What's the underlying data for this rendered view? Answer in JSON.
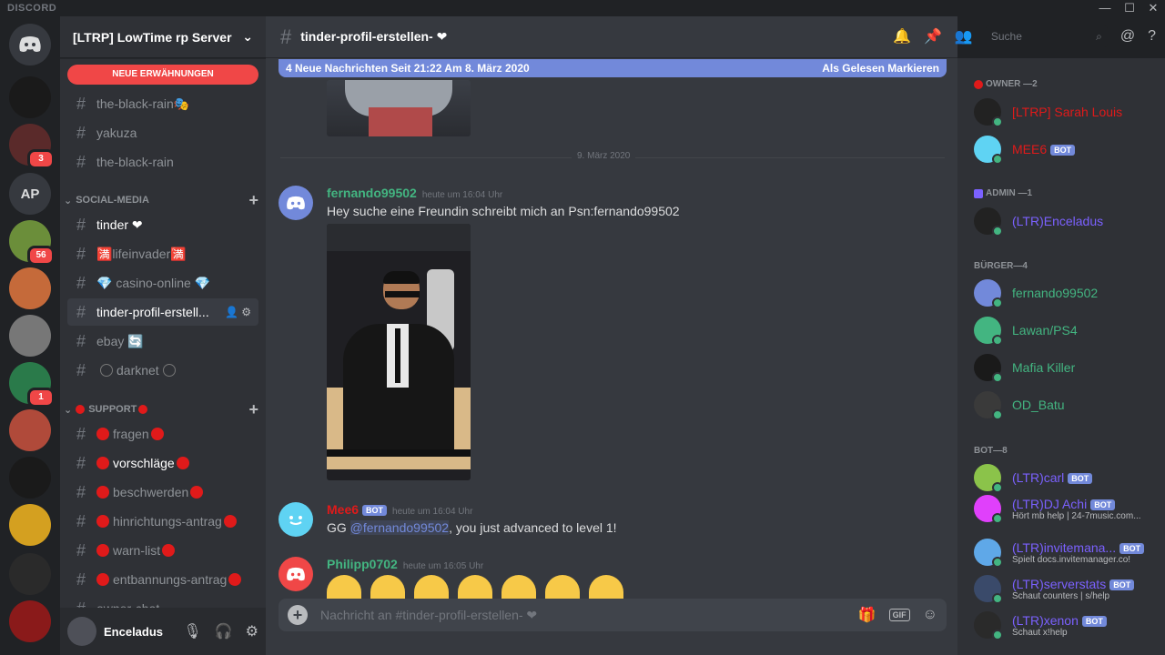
{
  "window": {
    "brand": "DISCORD",
    "minimize": "—",
    "maximize": "☐",
    "close": "✕"
  },
  "guilds": [
    {
      "label": "",
      "color": "#1a1a1a",
      "badge": ""
    },
    {
      "label": "",
      "color": "#5a2a2a",
      "badge": "3"
    },
    {
      "label": "AP",
      "color": "#36393f",
      "badge": ""
    },
    {
      "label": "",
      "color": "#6b8e3a",
      "badge": "56"
    },
    {
      "label": "",
      "color": "#c56a3a",
      "badge": ""
    },
    {
      "label": "",
      "color": "#777",
      "badge": ""
    },
    {
      "label": "",
      "color": "#2a7a4a",
      "badge": "1"
    },
    {
      "label": "",
      "color": "#b04a3a",
      "badge": ""
    },
    {
      "label": "",
      "color": "#1a1a1a",
      "badge": ""
    },
    {
      "label": "",
      "color": "#d4a020",
      "badge": ""
    },
    {
      "label": "",
      "color": "#2a2a2a",
      "badge": ""
    },
    {
      "label": "",
      "color": "#8a1a1a",
      "badge": ""
    }
  ],
  "server": {
    "name": "[LTRP] LowTime rp Server",
    "mention_pill": "NEUE ERWÄHNUNGEN"
  },
  "channels_top": [
    {
      "name": "the-black-rain🎭",
      "state": "normal"
    },
    {
      "name": "yakuza",
      "state": "normal"
    },
    {
      "name": "the-black-rain",
      "state": "normal"
    }
  ],
  "cat_social": "SOCIAL-MEDIA",
  "channels_social": [
    {
      "name": "tinder ❤",
      "state": "unread"
    },
    {
      "name": "🈵lifeinvader🈵",
      "state": "normal"
    },
    {
      "name": "💎 casino-online 💎",
      "state": "normal"
    },
    {
      "name": "tinder-profil-erstell...",
      "state": "active"
    },
    {
      "name": "ebay 🔄",
      "state": "normal"
    },
    {
      "name": "darknet",
      "state": "normal"
    }
  ],
  "cat_support": "SUPPORT",
  "channels_support": [
    {
      "name": "fragen",
      "state": "normal"
    },
    {
      "name": "vorschläge",
      "state": "unread"
    },
    {
      "name": "beschwerden",
      "state": "normal"
    },
    {
      "name": "hinrichtungs-antrag",
      "state": "normal"
    },
    {
      "name": "warn-list",
      "state": "normal"
    },
    {
      "name": "entbannungs-antrag",
      "state": "normal"
    },
    {
      "name": "owner-chat",
      "state": "normal"
    }
  ],
  "user": {
    "name": "Enceladus"
  },
  "chat": {
    "channel": "tinder-profil-erstellen- ❤",
    "new_messages": "4 Neue Nachrichten Seit 21:22 Am 8. März 2020",
    "mark_read": "Als Gelesen Markieren",
    "date_divider": "9. März 2020",
    "search_placeholder": "Suche",
    "composer_placeholder": "Nachricht an #tinder-profil-erstellen- ❤"
  },
  "messages": [
    {
      "author": "fernando99502",
      "author_color": "#43b581",
      "time": "heute um 16:04 Uhr",
      "text": "Hey suche eine Freundin schreibt mich an Psn:fernando99502"
    },
    {
      "author": "Mee6",
      "author_color": "#e01a1a",
      "bot": "BOT",
      "time": "heute um 16:04 Uhr",
      "text_pre": "GG ",
      "mention": "@fernando99502",
      "text_post": ", you just advanced to level 1!"
    },
    {
      "author": "Philipp0702",
      "author_color": "#43b581",
      "time": "heute um 16:05 Uhr"
    }
  ],
  "members": {
    "owner_title": "OWNER —2",
    "admin_title": "ADMIN —1",
    "buerger_title": "BÜRGER—4",
    "bot_title": "BOT—8",
    "list": [
      {
        "name": "[LTRP] Sarah Louis",
        "color": "#e01a1a",
        "sub": "",
        "bot": ""
      },
      {
        "name": "MEE6",
        "color": "#e01a1a",
        "sub": "",
        "bot": "BOT"
      },
      {
        "name": "(LTR)Enceladus",
        "color": "#7b61ff",
        "sub": "",
        "bot": ""
      },
      {
        "name": "fernando99502",
        "color": "#43b581",
        "sub": "",
        "bot": ""
      },
      {
        "name": "Lawan/PS4",
        "color": "#43b581",
        "sub": "",
        "bot": ""
      },
      {
        "name": "Mafia Killer",
        "color": "#43b581",
        "sub": "",
        "bot": ""
      },
      {
        "name": "OD_Batu",
        "color": "#43b581",
        "sub": "",
        "bot": ""
      },
      {
        "name": "(LTR)carl",
        "color": "#7b61ff",
        "sub": "",
        "bot": "BOT"
      },
      {
        "name": "(LTR)DJ Achi",
        "color": "#7b61ff",
        "sub": "Hört mb help | 24-7music.com...",
        "bot": "BOT"
      },
      {
        "name": "(LTR)invitemana...",
        "color": "#7b61ff",
        "sub": "Spielt docs.invitemanager.co!",
        "bot": "BOT"
      },
      {
        "name": "(LTR)serverstats",
        "color": "#7b61ff",
        "sub": "Schaut counters | s/help",
        "bot": "BOT"
      },
      {
        "name": "(LTR)xenon",
        "color": "#7b61ff",
        "sub": "Schaut x!help",
        "bot": "BOT"
      }
    ]
  }
}
